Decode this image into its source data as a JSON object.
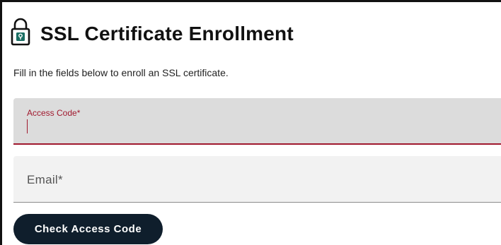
{
  "header": {
    "icon": "lock-icon",
    "title": "SSL Certificate Enrollment"
  },
  "subtitle": "Fill in the fields below to enroll an SSL certificate.",
  "form": {
    "access_code": {
      "label": "Access Code*",
      "value": ""
    },
    "email": {
      "placeholder": "Email*",
      "value": ""
    },
    "submit_label": "Check Access Code"
  },
  "colors": {
    "accent": "#a0192e",
    "button_bg": "#0f1e2c",
    "lock_icon": "#1a6e63",
    "active_field_bg": "#dcdcdc",
    "field_bg": "#f2f2f2"
  }
}
